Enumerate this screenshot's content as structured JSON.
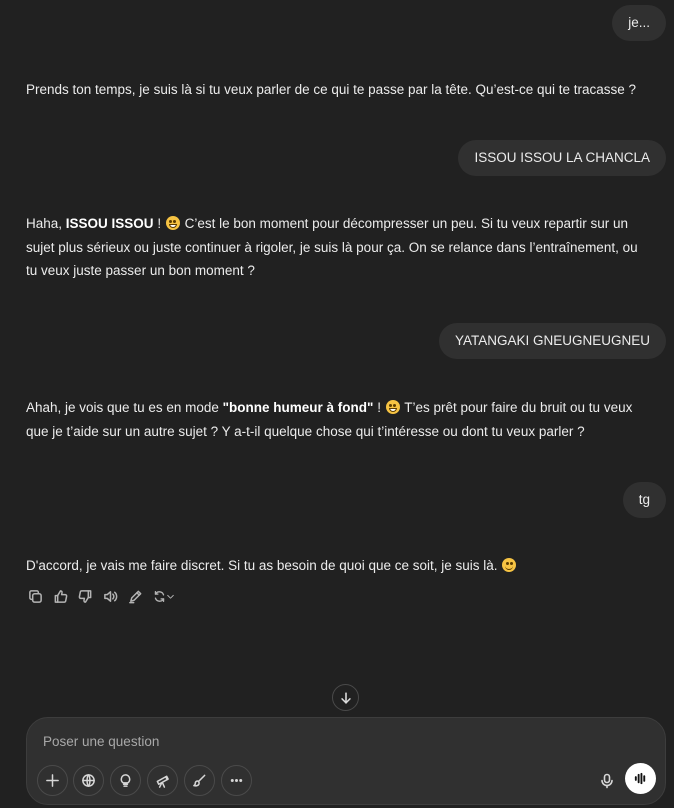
{
  "messages": [
    {
      "role": "user",
      "text": "je..."
    },
    {
      "role": "assistant",
      "text": "Prends ton temps, je suis là si tu veux parler de ce qui te passe par la tête. Qu’est-ce qui te tracasse ?"
    },
    {
      "role": "user",
      "text": "ISSOU ISSOU LA CHANCLA"
    },
    {
      "role": "assistant",
      "segments": {
        "pre": "Haha, ",
        "bold": "ISSOU ISSOU",
        "mid": " ! ",
        "post": " C’est le bon moment pour décompresser un peu. Si tu veux repartir sur un sujet plus sérieux ou juste continuer à rigoler, je suis là pour ça. On se relance dans l’entraînement, ou tu veux juste passer un bon moment ?"
      }
    },
    {
      "role": "user",
      "text": "YATANGAKI GNEUGNEUGNEU"
    },
    {
      "role": "assistant",
      "segments": {
        "pre": "Ahah, je vois que tu es en mode ",
        "bold": "\"bonne humeur à fond\"",
        "mid": " ! ",
        "post": " T’es prêt pour faire du bruit ou tu veux que je t’aide sur un autre sujet ? Y a-t-il quelque chose qui t’intéresse ou dont tu veux parler ?"
      }
    },
    {
      "role": "user",
      "text": "tg"
    },
    {
      "role": "assistant",
      "text": "D'accord, je vais me faire discret. Si tu as besoin de quoi que ce soit, je suis là. "
    }
  ],
  "message_actions": [
    "copy-icon",
    "thumbs-up-icon",
    "thumbs-down-icon",
    "read-aloud-icon",
    "edit-icon",
    "regenerate-icon"
  ],
  "composer": {
    "placeholder": "Poser une question",
    "tools": [
      "plus-icon",
      "globe-icon",
      "lightbulb-icon",
      "telescope-icon",
      "paintbrush-icon",
      "more-icon"
    ]
  },
  "colors": {
    "background": "#212121",
    "user_bubble": "#303030",
    "text": "#ececec",
    "composer": "#303030"
  }
}
